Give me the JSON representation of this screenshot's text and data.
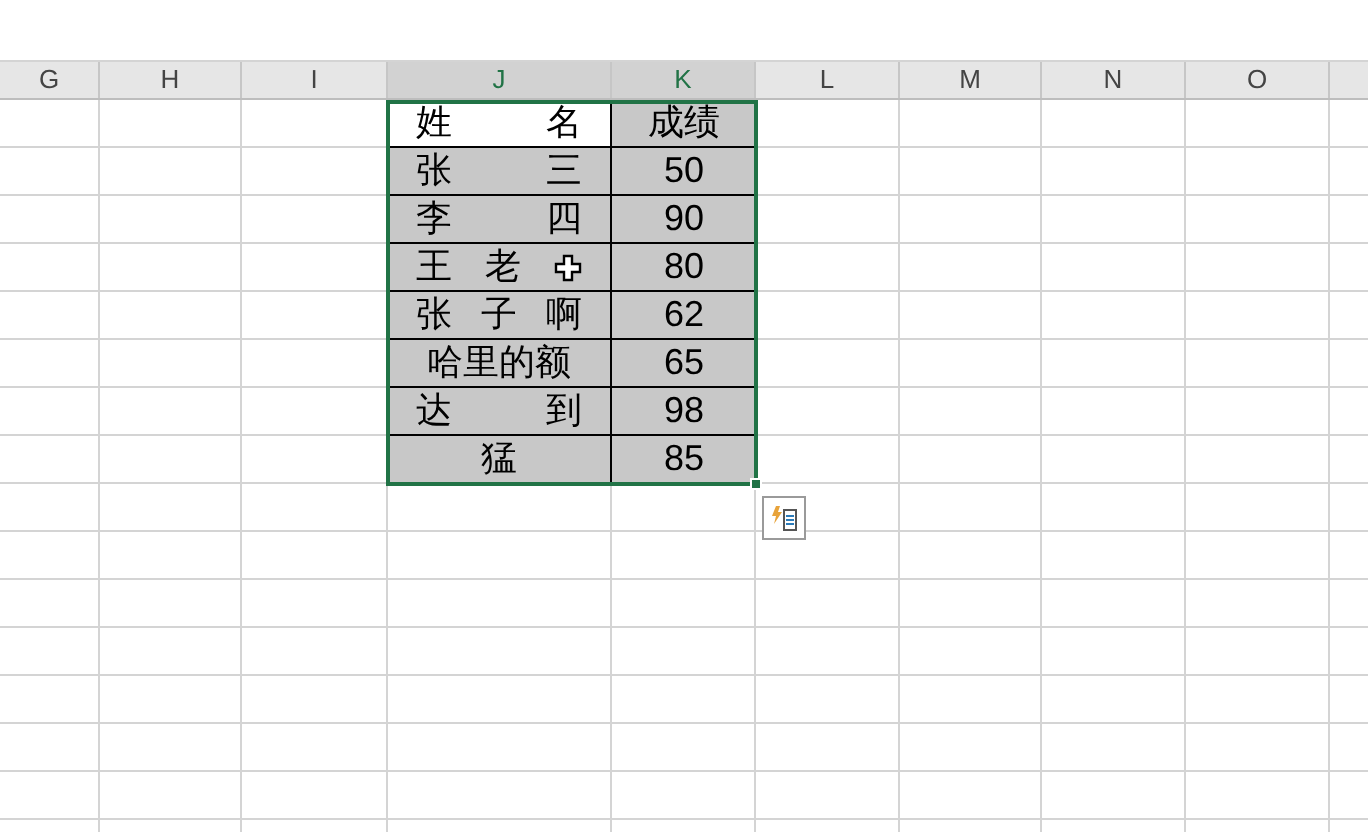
{
  "columns": [
    {
      "label": "G",
      "selected": false
    },
    {
      "label": "H",
      "selected": false
    },
    {
      "label": "I",
      "selected": false
    },
    {
      "label": "J",
      "selected": true
    },
    {
      "label": "K",
      "selected": true
    },
    {
      "label": "L",
      "selected": false
    },
    {
      "label": "M",
      "selected": false
    },
    {
      "label": "N",
      "selected": false
    },
    {
      "label": "O",
      "selected": false
    }
  ],
  "table": {
    "rows": [
      {
        "name": "姓 名",
        "score": "成绩",
        "header": true,
        "cursor": false
      },
      {
        "name": "张 三",
        "score": "50",
        "header": false,
        "cursor": false
      },
      {
        "name": "李 四",
        "score": "90",
        "header": false,
        "cursor": false
      },
      {
        "name": "王 老",
        "score": "80",
        "header": false,
        "cursor": true
      },
      {
        "name": "张 子 啊",
        "score": "62",
        "header": false,
        "cursor": false
      },
      {
        "name": "哈里的额",
        "score": "65",
        "header": false,
        "cursor": false
      },
      {
        "name": "达 到",
        "score": "98",
        "header": false,
        "cursor": false
      },
      {
        "name": "猛",
        "score": "85",
        "header": false,
        "cursor": false
      }
    ]
  }
}
